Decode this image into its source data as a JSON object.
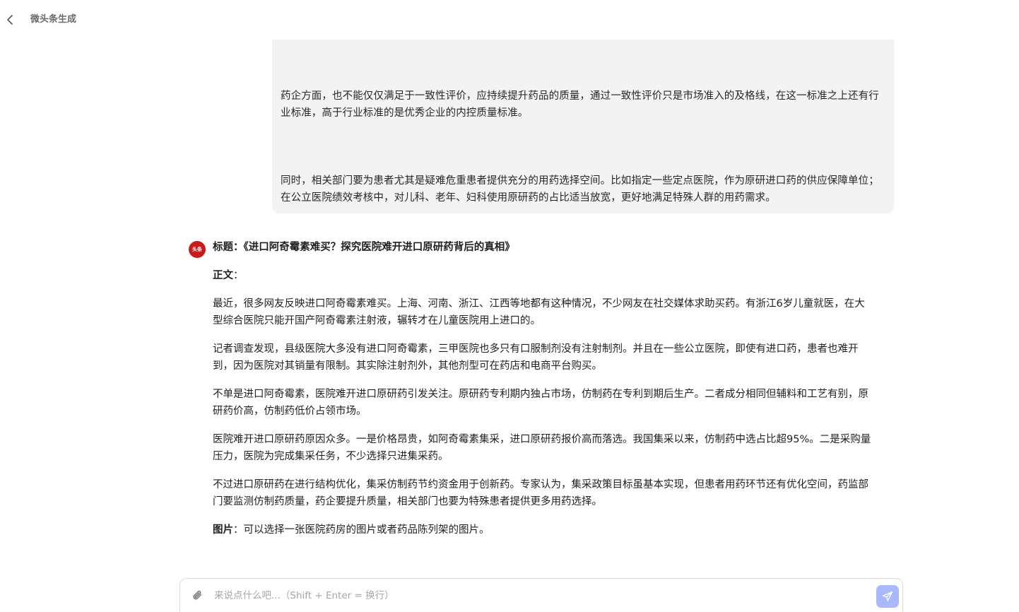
{
  "header": {
    "title": "微头条生成"
  },
  "user_message": {
    "paragraphs": [
      "药企方面，也不能仅仅满足于一致性评价，应持续提升药品的质量，通过一致性评价只是市场准入的及格线，在这一标准之上还有行业标准，高于行业标准的是优秀企业的内控质量标准。",
      "同时，相关部门要为患者尤其是疑难危重患者提供充分的用药选择空间。比如指定一些定点医院，作为原研进口药的供应保障单位；在公立医院绩效考核中，对儿科、老年、妇科使用原研药的占比适当放宽，更好地满足特殊人群的用药需求。"
    ]
  },
  "bot_message": {
    "avatar_text": "头条",
    "title_label": "标题：",
    "title_text": "《进口阿奇霉素难买？探究医院难开进口原研药背后的真相》",
    "body_label": "正文",
    "body_colon": "：",
    "paragraphs": [
      "最近，很多网友反映进口阿奇霉素难买。上海、河南、浙江、江西等地都有这种情况，不少网友在社交媒体求助买药。有浙江6岁儿童就医，在大型综合医院只能开国产阿奇霉素注射液，辗转才在儿童医院用上进口的。",
      "记者调查发现，县级医院大多没有进口阿奇霉素，三甲医院也多只有口服制剂没有注射制剂。并且在一些公立医院，即使有进口药，患者也难开到，因为医院对其销量有限制。其实除注射剂外，其他剂型可在药店和电商平台购买。",
      "不单是进口阿奇霉素，医院难开进口原研药引发关注。原研药专利期内独占市场，仿制药在专利到期后生产。二者成分相同但辅料和工艺有别，原研药价高，仿制药低价占领市场。",
      "医院难开进口原研药原因众多。一是价格昂贵，如阿奇霉素集采，进口原研药报价高而落选。我国集采以来，仿制药中选占比超95%。二是采购量压力，医院为完成集采任务，不少选择只进集采药。",
      "不过进口原研药在进行结构优化，集采仿制药节约资金用于创新药。专家认为，集采政策目标虽基本实现，但患者用药环节还有优化空间，药监部门要监测仿制药质量，药企要提升质量，相关部门也要为特殊患者提供更多用药选择。"
    ],
    "image_label": "图片",
    "image_colon": "：",
    "image_text": "可以选择一张医院药房的图片或者药品陈列架的图片。"
  },
  "input": {
    "value": "",
    "placeholder": "来说点什么吧...（Shift + Enter = 换行）"
  },
  "colors": {
    "send_button": "#a9b8fb",
    "avatar": "#c71b1b",
    "bubble_bg": "#f3f3f3"
  },
  "icons": {
    "back": "chevron-left-icon",
    "attach": "paperclip-icon",
    "send": "paper-plane-icon"
  }
}
